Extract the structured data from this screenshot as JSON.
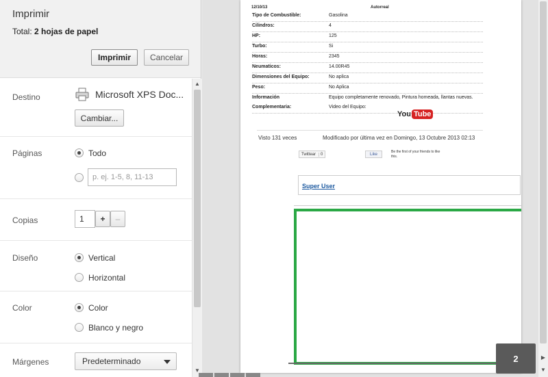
{
  "header": {
    "title": "Imprimir",
    "summary_prefix": "Total:",
    "summary_value": "2 hojas de papel",
    "print_label": "Imprimir",
    "cancel_label": "Cancelar"
  },
  "settings": {
    "destination": {
      "label": "Destino",
      "printer": "Microsoft XPS Doc...",
      "change_label": "Cambiar..."
    },
    "pages": {
      "label": "Páginas",
      "all_label": "Todo",
      "range_placeholder": "p. ej. 1-5, 8, 11-13"
    },
    "copies": {
      "label": "Copias",
      "value": "1",
      "plus": "+",
      "minus": "–"
    },
    "layout": {
      "label": "Diseño",
      "portrait": "Vertical",
      "landscape": "Horizontal"
    },
    "color": {
      "label": "Color",
      "color_label": "Color",
      "bw_label": "Blanco y negro"
    },
    "margins": {
      "label": "Márgenes",
      "value": "Predeterminado"
    }
  },
  "preview": {
    "top_date": "12/10/13",
    "top_brand": "Autorreal",
    "specs": [
      {
        "k": "Tipo de Combustible:",
        "v": "Gasolina"
      },
      {
        "k": "Cilindros:",
        "v": "4"
      },
      {
        "k": "HP:",
        "v": "125"
      },
      {
        "k": "Turbo:",
        "v": "Si"
      },
      {
        "k": "Horas:",
        "v": "2345"
      },
      {
        "k": "Neumaticos:",
        "v": "14.00R45"
      },
      {
        "k": "Dimensiones del Equipo:",
        "v": "No aplica"
      },
      {
        "k": "Peso:",
        "v": "No Aplica"
      },
      {
        "k": "Información",
        "v": "Equipo completamente renovado, Pintura homeada, llantas nuevas."
      },
      {
        "k": "Complementaria:",
        "v": "Video del Equipo:"
      }
    ],
    "youtube_you": "You",
    "youtube_tube": "Tube",
    "visto": "Visto 131 veces",
    "modified": "Modificado por última vez en Domingo, 13 Octubre 2013 02:13",
    "twitter_label": "Twittear",
    "twitter_count": "0",
    "like_label": "Like",
    "like_text": "Be the first of your friends to like this.",
    "author": "Super User",
    "page_number": "2"
  },
  "colors": {
    "accent_green": "#2aa845",
    "youtube_red": "#d62222"
  }
}
